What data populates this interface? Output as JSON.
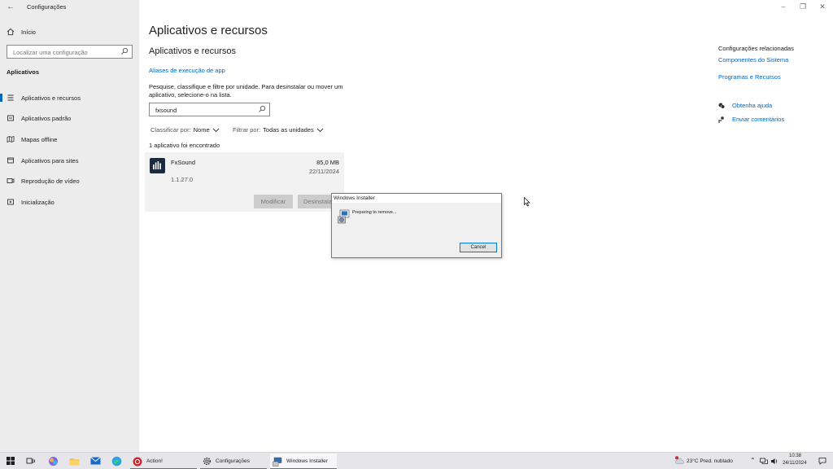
{
  "window": {
    "title": "Configurações",
    "back_icon": "back-arrow-icon",
    "controls": [
      "minimize",
      "restore",
      "close"
    ]
  },
  "sidebar": {
    "home_label": "Início",
    "search_placeholder": "Localizar uma configuração",
    "section_title": "Aplicativos",
    "items": [
      {
        "label": "Aplicativos e recursos",
        "icon": "list-icon",
        "active": true
      },
      {
        "label": "Aplicativos padrão",
        "icon": "default-apps-icon",
        "active": false
      },
      {
        "label": "Mapas offline",
        "icon": "map-icon",
        "active": false
      },
      {
        "label": "Aplicativos para sites",
        "icon": "web-apps-icon",
        "active": false
      },
      {
        "label": "Reprodução de vídeo",
        "icon": "video-icon",
        "active": false
      },
      {
        "label": "Inicialização",
        "icon": "startup-icon",
        "active": false
      }
    ]
  },
  "main": {
    "page_title": "Aplicativos e recursos",
    "section_title": "Aplicativos e recursos",
    "alias_link": "Aliases de execução de app",
    "description": "Pesquise, classifique e filtre por unidade. Para desinstalar ou mover um aplicativo, selecione-o na lista.",
    "filter_value": "fxsound",
    "sort": {
      "label": "Classificar por:",
      "value": "Nome"
    },
    "filter": {
      "label": "Filtrar por:",
      "value": "Todas as unidades"
    },
    "result_count": "1 aplicativo foi encontrado",
    "app": {
      "name": "FxSound",
      "size": "85,0 MB",
      "date": "22/11/2024",
      "version": "1.1.27.0",
      "modify_label": "Modificar",
      "uninstall_label": "Desinstalar"
    }
  },
  "related": {
    "title": "Configurações relacionadas",
    "links": [
      "Componentes do Sistema",
      "Programas e Recursos"
    ],
    "help_label": "Obtenha ajuda",
    "feedback_label": "Enviar comentários"
  },
  "dialog": {
    "title": "Windows Installer",
    "message": "Preparing to remove...",
    "cancel_label": "Cancel"
  },
  "taskbar": {
    "tasks": [
      {
        "label": "Action!",
        "icon": "action-app-icon"
      },
      {
        "label": "Configurações",
        "icon": "gear-icon"
      },
      {
        "label": "Windows Installer",
        "icon": "installer-icon"
      }
    ],
    "weather": "23°C  Pred. nublado",
    "time": "10:38",
    "date": "24/11/2024"
  },
  "colors": {
    "accent": "#0067c0",
    "sidebar_bg": "#ececec",
    "card_bg": "#f2f2f2"
  }
}
